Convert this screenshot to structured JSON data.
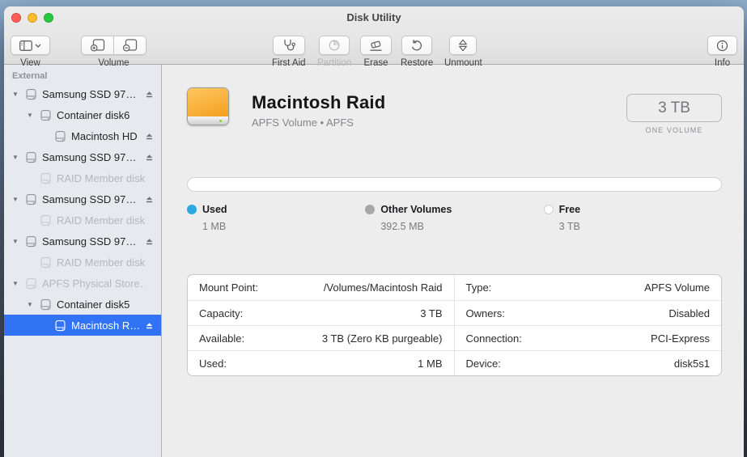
{
  "window": {
    "title": "Disk Utility"
  },
  "toolbar": {
    "view": {
      "label": "View"
    },
    "volume": {
      "label": "Volume"
    },
    "buttons": [
      {
        "id": "first-aid",
        "label": "First Aid",
        "enabled": true
      },
      {
        "id": "partition",
        "label": "Partition",
        "enabled": false
      },
      {
        "id": "erase",
        "label": "Erase",
        "enabled": true
      },
      {
        "id": "restore",
        "label": "Restore",
        "enabled": true
      },
      {
        "id": "unmount",
        "label": "Unmount",
        "enabled": true
      }
    ],
    "info": {
      "label": "Info"
    }
  },
  "icons": {
    "view": "sidebar-panel-icon",
    "view_chevron": "chevron-down-icon",
    "volume_add": "add-volume-icon",
    "volume_remove": "remove-volume-icon",
    "first_aid": "stethoscope-icon",
    "partition": "pie-chart-icon",
    "erase": "eraser-icon",
    "restore": "counterclockwise-arrow-icon",
    "unmount": "mount-toggle-icon",
    "info": "info-circle-icon",
    "sidebar_drive": "drive-icon",
    "eject": "eject-icon",
    "disclosure": "disclosure-triangle-icon",
    "volume_icon": "orange-external-drive-icon"
  },
  "sidebar": {
    "section": "External",
    "items": [
      {
        "label": "Samsung SSD 97…",
        "level": 0,
        "disclosure": true,
        "eject": true,
        "dimmed": false,
        "selected": false
      },
      {
        "label": "Container disk6",
        "level": 1,
        "disclosure": true,
        "eject": false,
        "dimmed": false,
        "selected": false
      },
      {
        "label": "Macintosh HD",
        "level": 2,
        "disclosure": false,
        "eject": true,
        "dimmed": false,
        "selected": false
      },
      {
        "label": "Samsung SSD 97…",
        "level": 0,
        "disclosure": true,
        "eject": true,
        "dimmed": false,
        "selected": false
      },
      {
        "label": "RAID Member disk…",
        "level": 1,
        "disclosure": false,
        "eject": false,
        "dimmed": true,
        "selected": false
      },
      {
        "label": "Samsung SSD 97…",
        "level": 0,
        "disclosure": true,
        "eject": true,
        "dimmed": false,
        "selected": false
      },
      {
        "label": "RAID Member disk…",
        "level": 1,
        "disclosure": false,
        "eject": false,
        "dimmed": true,
        "selected": false
      },
      {
        "label": "Samsung SSD 97…",
        "level": 0,
        "disclosure": true,
        "eject": true,
        "dimmed": false,
        "selected": false
      },
      {
        "label": "RAID Member disk…",
        "level": 1,
        "disclosure": false,
        "eject": false,
        "dimmed": true,
        "selected": false
      },
      {
        "label": "APFS Physical Store…",
        "level": 0,
        "disclosure": true,
        "eject": false,
        "dimmed": true,
        "selected": false
      },
      {
        "label": "Container disk5",
        "level": 1,
        "disclosure": true,
        "eject": false,
        "dimmed": false,
        "selected": false
      },
      {
        "label": "Macintosh R…",
        "level": 2,
        "disclosure": false,
        "eject": true,
        "dimmed": false,
        "selected": true
      }
    ],
    "selection_color": "#3273f5"
  },
  "main": {
    "volume_title": "Macintosh Raid",
    "volume_subtitle": "APFS Volume • APFS",
    "size_badge": "3 TB",
    "size_caption": "ONE VOLUME",
    "legend": [
      {
        "label": "Used",
        "value": "1 MB",
        "color": "#29abe2"
      },
      {
        "label": "Other Volumes",
        "value": "392.5 MB",
        "color": "#a7a7a7"
      },
      {
        "label": "Free",
        "value": "3 TB",
        "color": "#ffffff"
      }
    ],
    "details": {
      "left": [
        [
          "Mount Point:",
          "/Volumes/Macintosh Raid"
        ],
        [
          "Capacity:",
          "3 TB"
        ],
        [
          "Available:",
          "3 TB (Zero KB purgeable)"
        ],
        [
          "Used:",
          "1 MB"
        ]
      ],
      "right": [
        [
          "Type:",
          "APFS Volume"
        ],
        [
          "Owners:",
          "Disabled"
        ],
        [
          "Connection:",
          "PCI-Express"
        ],
        [
          "Device:",
          "disk5s1"
        ]
      ]
    }
  }
}
